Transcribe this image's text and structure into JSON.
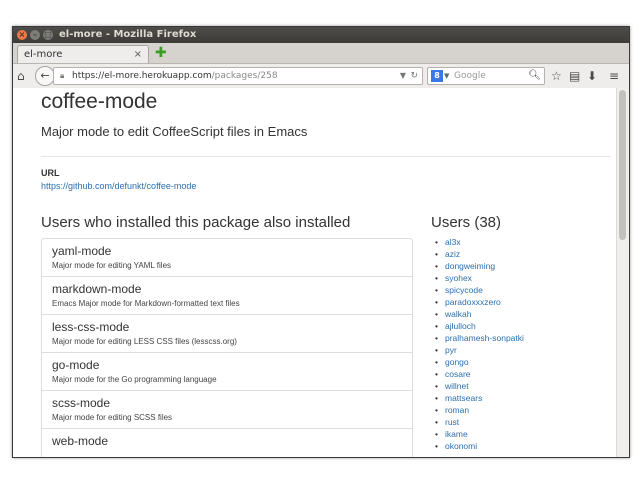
{
  "window": {
    "title": "el-more - Mozilla Firefox",
    "tab_label": "el-more",
    "tab_close": "×",
    "new_tab": "✚"
  },
  "navbar": {
    "url_host": "https://el-more.herokuapp.com",
    "url_path": "/packages/258",
    "search_placeholder": "Google",
    "search_engine_letter": "8"
  },
  "package": {
    "name": "coffee-mode",
    "description": "Major mode to edit CoffeeScript files in Emacs",
    "url_label": "URL",
    "url": "https://github.com/defunkt/coffee-mode"
  },
  "also_installed": {
    "heading": "Users who installed this package also installed",
    "items": [
      {
        "name": "yaml-mode",
        "desc": "Major mode for editing YAML files"
      },
      {
        "name": "markdown-mode",
        "desc": "Emacs Major mode for Markdown-formatted text files"
      },
      {
        "name": "less-css-mode",
        "desc": "Major mode for editing LESS CSS files (lesscss.org)"
      },
      {
        "name": "go-mode",
        "desc": "Major mode for the Go programming language"
      },
      {
        "name": "scss-mode",
        "desc": "Major mode for editing SCSS files"
      },
      {
        "name": "web-mode",
        "desc": ""
      }
    ]
  },
  "users": {
    "heading": "Users (38)",
    "list": [
      "al3x",
      "aziz",
      "dongweiming",
      "syohex",
      "spicycode",
      "paradoxxxzero",
      "walkah",
      "ajlulloch",
      "pralhamesh-sonpatki",
      "pyr",
      "gongo",
      "cosare",
      "willnet",
      "mattsears",
      "roman",
      "rust",
      "ikame",
      "okonomi"
    ]
  }
}
